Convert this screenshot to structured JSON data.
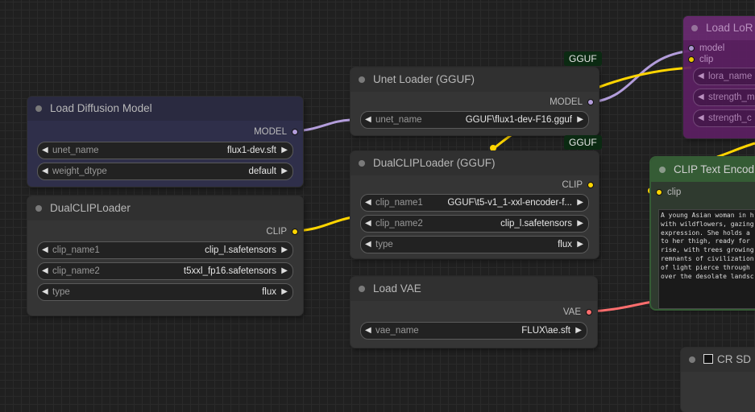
{
  "badges": {
    "gguf_unet": "GGUF",
    "gguf_clip": "GGUF"
  },
  "load_diffusion": {
    "title": "Load Diffusion Model",
    "output": "MODEL",
    "widgets": [
      {
        "label": "unet_name",
        "value": "flux1-dev.sft"
      },
      {
        "label": "weight_dtype",
        "value": "default"
      }
    ]
  },
  "dual_clip": {
    "title": "DualCLIPLoader",
    "output": "CLIP",
    "widgets": [
      {
        "label": "clip_name1",
        "value": "clip_l.safetensors"
      },
      {
        "label": "clip_name2",
        "value": "t5xxl_fp16.safetensors"
      },
      {
        "label": "type",
        "value": "flux"
      }
    ]
  },
  "unet_gguf": {
    "title": "Unet Loader (GGUF)",
    "output": "MODEL",
    "widgets": [
      {
        "label": "unet_name",
        "value": "GGUF\\flux1-dev-F16.gguf"
      }
    ]
  },
  "dual_clip_gguf": {
    "title": "DualCLIPLoader (GGUF)",
    "output": "CLIP",
    "widgets": [
      {
        "label": "clip_name1",
        "value": "GGUF\\t5-v1_1-xxl-encoder-f..."
      },
      {
        "label": "clip_name2",
        "value": "clip_l.safetensors"
      },
      {
        "label": "type",
        "value": "flux"
      }
    ]
  },
  "load_vae": {
    "title": "Load VAE",
    "output": "VAE",
    "widgets": [
      {
        "label": "vae_name",
        "value": "FLUX\\ae.sft"
      }
    ]
  },
  "load_lora": {
    "title": "Load LoR",
    "inputs": [
      "model",
      "clip"
    ],
    "widgets": [
      "lora_name",
      "strength_m",
      "strength_c"
    ]
  },
  "clip_text": {
    "title": "CLIP Text Encod",
    "input": "clip",
    "prompt": "A young Asian woman in h\nwith wildflowers, gazing\nexpression. She holds a \nto her thigh, ready for \nrise, with trees growing\nremnants of civilization\nof light pierce through \nover the desolate landsc"
  },
  "cr_node": {
    "title": "CR SD"
  },
  "colors": {
    "model": "#b39ddb",
    "clip": "#ffd500",
    "vae": "#ff6e6e",
    "lora_bg": "#5c1f63",
    "clip_text_border": "#355c35",
    "diffusion_bg": "#2f2f4a"
  }
}
